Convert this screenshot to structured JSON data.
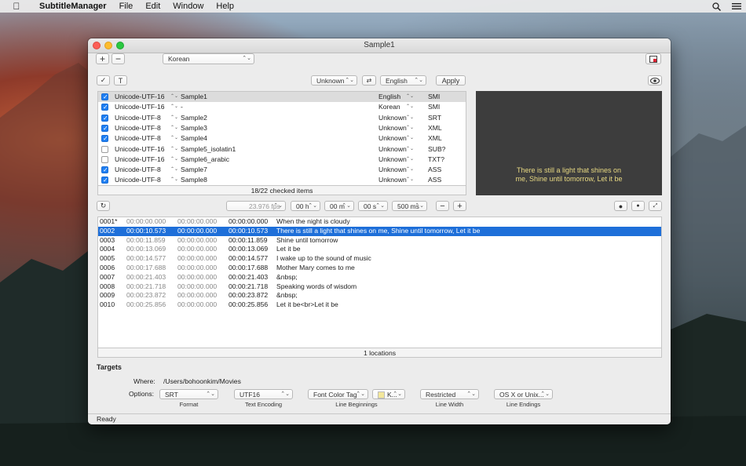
{
  "menubar": {
    "app": "SubtitleManager",
    "items": [
      "File",
      "Edit",
      "Window",
      "Help"
    ]
  },
  "window": {
    "title": "Sample1",
    "language_popup": "Korean"
  },
  "edit_bar": {
    "encoding_popup": "Unknown",
    "target_language_popup": "English",
    "apply_label": "Apply"
  },
  "files": {
    "rows": [
      {
        "checked": true,
        "encoding": "Unicode-UTF-16",
        "name": "Sample1",
        "language": "English",
        "format": "SMI",
        "selected": true
      },
      {
        "checked": true,
        "encoding": "Unicode-UTF-16",
        "name": "-",
        "language": "Korean",
        "format": "SMI"
      },
      {
        "checked": true,
        "encoding": "Unicode-UTF-8",
        "name": "Sample2",
        "language": "Unknown",
        "format": "SRT"
      },
      {
        "checked": true,
        "encoding": "Unicode-UTF-8",
        "name": "Sample3",
        "language": "Unknown",
        "format": "XML"
      },
      {
        "checked": true,
        "encoding": "Unicode-UTF-8",
        "name": "Sample4",
        "language": "Unknown",
        "format": "XML"
      },
      {
        "checked": false,
        "encoding": "Unicode-UTF-16",
        "name": "Sample5_isolatin1",
        "language": "Unknown",
        "format": "SUB?"
      },
      {
        "checked": false,
        "encoding": "Unicode-UTF-16",
        "name": "Sample6_arabic",
        "language": "Unknown",
        "format": "TXT?"
      },
      {
        "checked": true,
        "encoding": "Unicode-UTF-8",
        "name": "Sample7",
        "language": "Unknown",
        "format": "ASS"
      },
      {
        "checked": true,
        "encoding": "Unicode-UTF-8",
        "name": "Sample8",
        "language": "Unknown",
        "format": "ASS"
      }
    ],
    "footer": "18/22 checked items"
  },
  "preview": {
    "line1": "There is still a light that shines on",
    "line2": "me, Shine until tomorrow, Let it be"
  },
  "timing": {
    "fps": "23.976 fps",
    "hours": "00 h",
    "minutes": "00 m",
    "seconds": "00 s",
    "ms": "500 ms"
  },
  "subtitles": {
    "rows": [
      {
        "index": "0001*",
        "start": "00:00:00.000",
        "duration": "00:00:00.000",
        "end": "00:00:00.000",
        "text": "When the night is cloudy"
      },
      {
        "index": "0002",
        "start": "00:00:10.573",
        "duration": "00:00:00.000",
        "end": "00:00:10.573",
        "text": "There is still a light that shines on me, Shine until tomorrow, Let it be",
        "selected": true
      },
      {
        "index": "0003",
        "start": "00:00:11.859",
        "duration": "00:00:00.000",
        "end": "00:00:11.859",
        "text": "Shine until tomorrow"
      },
      {
        "index": "0004",
        "start": "00:00:13.069",
        "duration": "00:00:00.000",
        "end": "00:00:13.069",
        "text": "Let it be"
      },
      {
        "index": "0005",
        "start": "00:00:14.577",
        "duration": "00:00:00.000",
        "end": "00:00:14.577",
        "text": "I wake up to the sound of music"
      },
      {
        "index": "0006",
        "start": "00:00:17.688",
        "duration": "00:00:00.000",
        "end": "00:00:17.688",
        "text": "Mother Mary comes to me"
      },
      {
        "index": "0007",
        "start": "00:00:21.403",
        "duration": "00:00:00.000",
        "end": "00:00:21.403",
        "text": "&nbsp;"
      },
      {
        "index": "0008",
        "start": "00:00:21.718",
        "duration": "00:00:00.000",
        "end": "00:00:21.718",
        "text": "Speaking words of wisdom"
      },
      {
        "index": "0009",
        "start": "00:00:23.872",
        "duration": "00:00:00.000",
        "end": "00:00:23.872",
        "text": "&nbsp;"
      },
      {
        "index": "0010",
        "start": "00:00:25.856",
        "duration": "00:00:00.000",
        "end": "00:00:25.856",
        "text": "Let it be<br>Let it be"
      }
    ],
    "footer": "1 locations"
  },
  "targets": {
    "heading": "Targets",
    "where_label": "Where:",
    "where_value": "/Users/bohoonkim/Movies",
    "options_label": "Options:",
    "options": [
      {
        "value": "SRT",
        "caption": "Format"
      },
      {
        "value": "UTF16",
        "caption": "Text Encoding"
      },
      {
        "value": "Font Color Tag",
        "extra": "K...",
        "caption": "Line Beginnings"
      },
      {
        "value": "Restricted",
        "caption": "Line Width"
      },
      {
        "value": "OS X or Unix...",
        "caption": "Line Endings"
      }
    ]
  },
  "status": "Ready",
  "colors": {
    "selection": "#1e6fd9",
    "checkbox": "#1e7ef2",
    "preview_bg": "#3d3d3d",
    "preview_text": "#e8d982"
  }
}
